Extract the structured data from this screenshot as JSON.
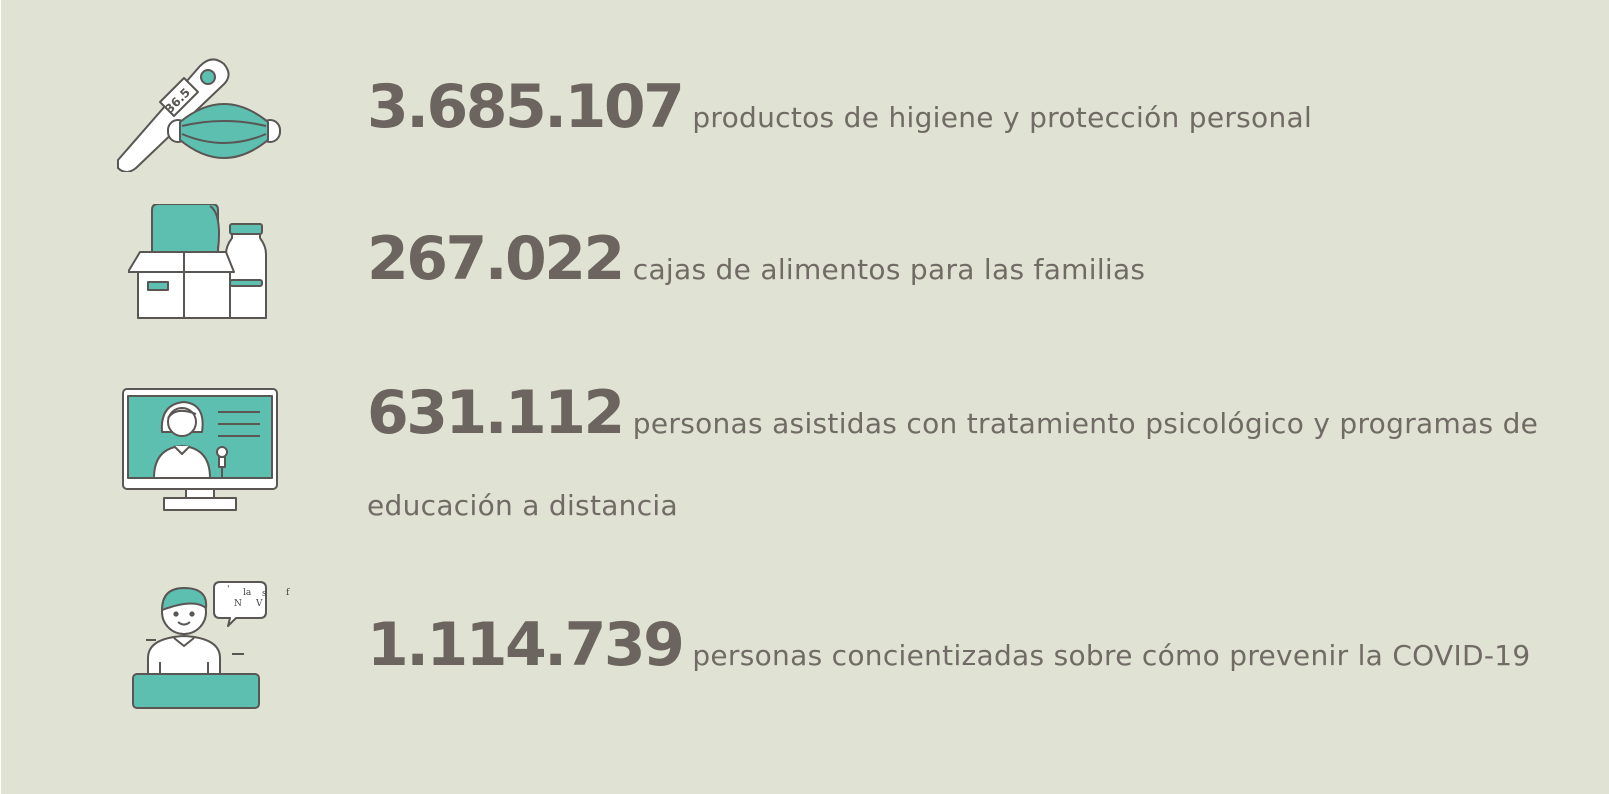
{
  "colors": {
    "background": "#e0e3d4",
    "accent": "#5cbfb0",
    "text": "#6b645f",
    "outline": "#5a5654"
  },
  "stats": [
    {
      "number": "3.685.107",
      "text": "productos de higiene y protección personal",
      "icon": "thermometer-mask-icon",
      "thermometer_reading": "36.5"
    },
    {
      "number": "267.022",
      "text": "cajas de alimentos para las familias",
      "icon": "food-box-icon"
    },
    {
      "number": "631.112",
      "text_line1": "personas asistidas con tratamiento psicológico y programas de",
      "text_line2": "educación a distancia",
      "icon": "online-teaching-monitor-icon"
    },
    {
      "number": "1.114.739",
      "text": "personas concientizadas sobre cómo prevenir la COVID-19",
      "icon": "person-speech-bubble-icon",
      "bubble_chars": [
        "'",
        "la",
        "s",
        "N",
        "V",
        "f"
      ]
    }
  ]
}
